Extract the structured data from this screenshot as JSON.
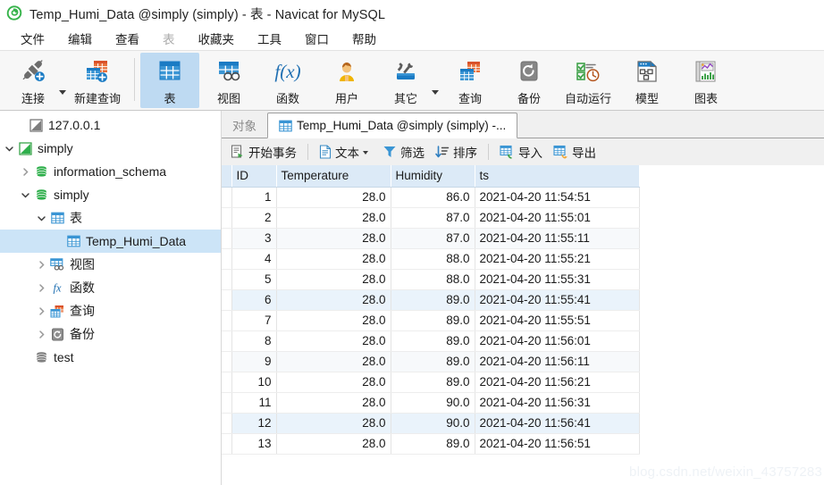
{
  "window": {
    "title": "Temp_Humi_Data @simply (simply) - 表 - Navicat for MySQL",
    "logo_icon": "navicat-logo-icon"
  },
  "menubar": {
    "items": [
      {
        "label": "文件",
        "disabled": false
      },
      {
        "label": "编辑",
        "disabled": false
      },
      {
        "label": "查看",
        "disabled": false
      },
      {
        "label": "表",
        "disabled": true
      },
      {
        "label": "收藏夹",
        "disabled": false
      },
      {
        "label": "工具",
        "disabled": false
      },
      {
        "label": "窗口",
        "disabled": false
      },
      {
        "label": "帮助",
        "disabled": false
      }
    ]
  },
  "toolbar": {
    "buttons": [
      {
        "label": "连接",
        "icon": "connection-icon",
        "selected": false,
        "caret": true
      },
      {
        "label": "新建查询",
        "icon": "new-query-icon",
        "selected": false,
        "caret": false
      },
      {
        "label": "表",
        "icon": "table-icon",
        "selected": true,
        "caret": false
      },
      {
        "label": "视图",
        "icon": "view-icon",
        "selected": false,
        "caret": false
      },
      {
        "label": "函数",
        "icon": "function-fx-icon",
        "selected": false,
        "caret": false
      },
      {
        "label": "用户",
        "icon": "user-icon",
        "selected": false,
        "caret": false
      },
      {
        "label": "其它",
        "icon": "other-tools-icon",
        "selected": false,
        "caret": true
      },
      {
        "label": "查询",
        "icon": "query-icon",
        "selected": false,
        "caret": false
      },
      {
        "label": "备份",
        "icon": "backup-icon",
        "selected": false,
        "caret": false
      },
      {
        "label": "自动运行",
        "icon": "automation-icon",
        "selected": false,
        "caret": false
      },
      {
        "label": "模型",
        "icon": "model-icon",
        "selected": false,
        "caret": false
      },
      {
        "label": "图表",
        "icon": "chart-icon",
        "selected": false,
        "caret": false
      }
    ]
  },
  "sidebar": {
    "tree": [
      {
        "label": "127.0.0.1",
        "icon": "connection-gray-icon",
        "indent": 0,
        "twist": "none",
        "selected": false
      },
      {
        "label": "simply",
        "icon": "connection-green-icon",
        "indent": 0,
        "twist": "down",
        "selected": false
      },
      {
        "label": "information_schema",
        "icon": "database-icon",
        "indent": 1,
        "twist": "right",
        "selected": false
      },
      {
        "label": "simply",
        "icon": "database-icon",
        "indent": 1,
        "twist": "down",
        "selected": false
      },
      {
        "label": "表",
        "icon": "table-icon",
        "indent": 2,
        "twist": "down",
        "selected": false
      },
      {
        "label": "Temp_Humi_Data",
        "icon": "table-icon",
        "indent": 3,
        "twist": "none",
        "selected": true
      },
      {
        "label": "视图",
        "icon": "view-icon",
        "indent": 2,
        "twist": "right",
        "selected": false
      },
      {
        "label": "函数",
        "icon": "function-fx-icon",
        "indent": 2,
        "twist": "right",
        "selected": false
      },
      {
        "label": "查询",
        "icon": "query-icon",
        "indent": 2,
        "twist": "right",
        "selected": false
      },
      {
        "label": "备份",
        "icon": "backup-icon",
        "indent": 2,
        "twist": "right",
        "selected": false
      },
      {
        "label": "test",
        "icon": "database-icon",
        "indent": 1,
        "twist": "none",
        "selected": false
      }
    ]
  },
  "tabs": [
    {
      "label": "对象",
      "icon": null,
      "active": false
    },
    {
      "label": "Temp_Humi_Data @simply (simply) -...",
      "icon": "table-icon",
      "active": true
    }
  ],
  "gridbar": {
    "buttons": [
      {
        "label": "开始事务",
        "icon": "begin-transaction-icon",
        "caret": false
      },
      {
        "sep": true
      },
      {
        "label": "文本",
        "icon": "text-document-icon",
        "caret": true
      },
      {
        "label": "筛选",
        "icon": "filter-funnel-icon",
        "caret": false
      },
      {
        "label": "排序",
        "icon": "sort-icon",
        "caret": false
      },
      {
        "sep": true
      },
      {
        "label": "导入",
        "icon": "import-icon",
        "caret": false
      },
      {
        "label": "导出",
        "icon": "export-icon",
        "caret": false
      }
    ]
  },
  "grid": {
    "columns": [
      "ID",
      "Temperature",
      "Humidity",
      "ts"
    ],
    "rows": [
      {
        "id": "1",
        "temperature": "28.0",
        "humidity": "86.0",
        "ts": "2021-04-20 11:54:51",
        "style": "normal"
      },
      {
        "id": "2",
        "temperature": "28.0",
        "humidity": "87.0",
        "ts": "2021-04-20 11:55:01",
        "style": "normal"
      },
      {
        "id": "3",
        "temperature": "28.0",
        "humidity": "87.0",
        "ts": "2021-04-20 11:55:11",
        "style": "alt"
      },
      {
        "id": "4",
        "temperature": "28.0",
        "humidity": "88.0",
        "ts": "2021-04-20 11:55:21",
        "style": "normal"
      },
      {
        "id": "5",
        "temperature": "28.0",
        "humidity": "88.0",
        "ts": "2021-04-20 11:55:31",
        "style": "normal"
      },
      {
        "id": "6",
        "temperature": "28.0",
        "humidity": "89.0",
        "ts": "2021-04-20 11:55:41",
        "style": "hl"
      },
      {
        "id": "7",
        "temperature": "28.0",
        "humidity": "89.0",
        "ts": "2021-04-20 11:55:51",
        "style": "normal"
      },
      {
        "id": "8",
        "temperature": "28.0",
        "humidity": "89.0",
        "ts": "2021-04-20 11:56:01",
        "style": "normal"
      },
      {
        "id": "9",
        "temperature": "28.0",
        "humidity": "89.0",
        "ts": "2021-04-20 11:56:11",
        "style": "alt"
      },
      {
        "id": "10",
        "temperature": "28.0",
        "humidity": "89.0",
        "ts": "2021-04-20 11:56:21",
        "style": "normal"
      },
      {
        "id": "11",
        "temperature": "28.0",
        "humidity": "90.0",
        "ts": "2021-04-20 11:56:31",
        "style": "normal"
      },
      {
        "id": "12",
        "temperature": "28.0",
        "humidity": "90.0",
        "ts": "2021-04-20 11:56:41",
        "style": "hl"
      },
      {
        "id": "13",
        "temperature": "28.0",
        "humidity": "89.0",
        "ts": "2021-04-20 11:56:51",
        "style": "normal"
      }
    ]
  },
  "watermark": "blog.csdn.net/weixin_43757283",
  "colors": {
    "accent_blue": "#1a7bc4",
    "selection_blue": "#cce4f7",
    "toolbar_selected": "#bedaf2",
    "header_blue": "#dceaf7",
    "green": "#2eaf4b",
    "orange": "#e8703a"
  }
}
